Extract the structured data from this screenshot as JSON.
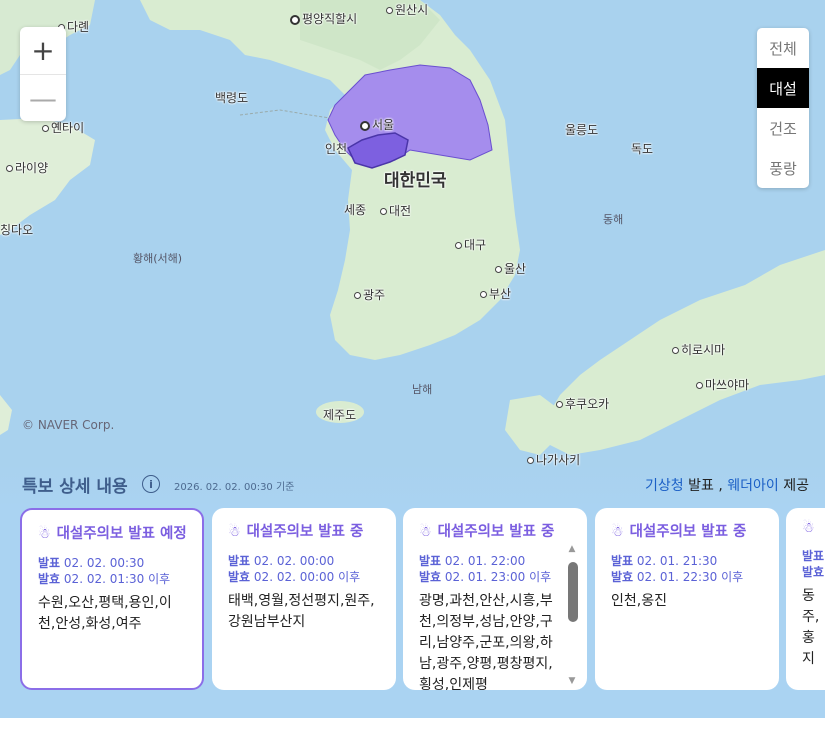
{
  "map": {
    "places": {
      "pyongyang": "평양직할시",
      "wonsan": "원산시",
      "dalian": "다롄",
      "baengnyeong": "백령도",
      "yantai": "옌타이",
      "laiyang": "라이양",
      "qingdao": "칭다오",
      "seoul": "서울",
      "incheon": "인천",
      "korea": "대한민국",
      "ulleung": "울릉도",
      "dokdo": "독도",
      "sejong": "세종",
      "daejeon": "대전",
      "east_sea": "동해",
      "yellow_sea": "황해(서해)",
      "daegu": "대구",
      "ulsan": "울산",
      "gwangju": "광주",
      "busan": "부산",
      "hiroshima": "히로시마",
      "matsuyama": "마쓰야마",
      "south_sea": "남해",
      "jeju": "제주도",
      "fukuoka": "후쿠오카",
      "nagasaki": "나가사키"
    },
    "copyright": "© NAVER Corp.",
    "zoom": {
      "in": "+",
      "out": "—"
    },
    "layers": [
      {
        "label": "전체",
        "active": false
      },
      {
        "label": "대설",
        "active": true
      },
      {
        "label": "건조",
        "active": false
      },
      {
        "label": "풍랑",
        "active": false
      }
    ],
    "warning_color": "#9b7cf2"
  },
  "panel": {
    "title": "특보 상세 내용",
    "info_icon": "i",
    "timestamp": "2026. 02. 02. 00:30 기준",
    "provider_a": "기상청",
    "provider_a_suffix": " 발표 , ",
    "provider_b": "웨더아이",
    "provider_b_suffix": " 제공",
    "cards": [
      {
        "title": "대설주의보 발표 예정",
        "announce_label": "발표",
        "announce": "02. 02. 00:30",
        "effect_label": "발효",
        "effect": "02. 02. 01:30 이후",
        "regions": "수원,오산,평택,용인,이천,안성,화성,여주"
      },
      {
        "title": "대설주의보 발표 중",
        "announce_label": "발표",
        "announce": "02. 02. 00:00",
        "effect_label": "발효",
        "effect": "02. 02. 00:00 이후",
        "regions": "태백,영월,정선평지,원주,강원남부산지"
      },
      {
        "title": "대설주의보 발표 중",
        "announce_label": "발표",
        "announce": "02. 01. 22:00",
        "effect_label": "발효",
        "effect": "02. 01. 23:00 이후",
        "regions": "광명,과천,안산,시흥,부천,의정부,성남,안양,구리,남양주,군포,의왕,하남,광주,양평,평창평지,횡성,인제평"
      },
      {
        "title": "대설주의보 발표 중",
        "announce_label": "발표",
        "announce": "02. 01. 21:30",
        "effect_label": "발효",
        "effect": "02. 01. 22:30 이후",
        "regions": "인천,옹진"
      },
      {
        "title": "",
        "announce_label": "발표",
        "announce": "",
        "effect_label": "발효",
        "effect": "",
        "regions": "동주,홍지"
      }
    ]
  }
}
